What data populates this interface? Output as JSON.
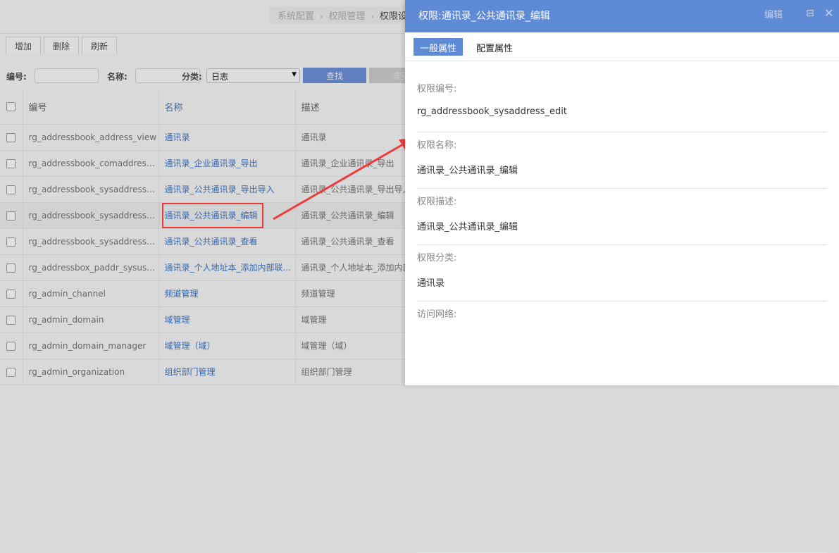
{
  "breadcrumb": [
    "系统配置",
    "权限管理",
    "权限设置"
  ],
  "toolbar": {
    "add": "增加",
    "delete": "删除",
    "refresh": "刷新"
  },
  "filter": {
    "id_label": "编号:",
    "id_value": "",
    "name_label": "名称:",
    "name_value": "",
    "category_label": "分类:",
    "category_value": "日志",
    "search": "查找",
    "clear": "清空"
  },
  "table": {
    "headers": [
      "编号",
      "名称",
      "描述"
    ],
    "rows": [
      {
        "id": "rg_addressbook_address_view",
        "name": "通讯录",
        "desc": "通讯录"
      },
      {
        "id": "rg_addressbook_comaddress_d...",
        "name": "通讯录_企业通讯录_导出",
        "desc": "通讯录_企业通讯录_导出"
      },
      {
        "id": "rg_addressbook_sysaddress_du...",
        "name": "通讯录_公共通讯录_导出导入",
        "desc": "通讯录_公共通讯录_导出导入"
      },
      {
        "id": "rg_addressbook_sysaddress_edit",
        "name": "通讯录_公共通讯录_编辑",
        "desc": "通讯录_公共通讯录_编辑"
      },
      {
        "id": "rg_addressbook_sysaddress_view",
        "name": "通讯录_公共通讯录_查看",
        "desc": "通讯录_公共通讯录_查看"
      },
      {
        "id": "rg_addressbox_paddr_sysusera...",
        "name": "通讯录_个人地址本_添加内部联...",
        "desc": "通讯录_个人地址本_添加内部联系人"
      },
      {
        "id": "rg_admin_channel",
        "name": "频道管理",
        "desc": "频道管理"
      },
      {
        "id": "rg_admin_domain",
        "name": "域管理",
        "desc": "域管理"
      },
      {
        "id": "rg_admin_domain_manager",
        "name": "域管理（域）",
        "desc": "域管理（域）"
      },
      {
        "id": "rg_admin_organization",
        "name": "组织部门管理",
        "desc": "组织部门管理"
      }
    ]
  },
  "panel": {
    "title": "权限:通讯录_公共通讯录_编辑",
    "edit": "编辑",
    "tabs": [
      "一般属性",
      "配置属性"
    ],
    "fields": [
      {
        "label": "权限编号:",
        "value": "rg_addressbook_sysaddress_edit"
      },
      {
        "label": "权限名称:",
        "value": "通讯录_公共通讯录_编辑"
      },
      {
        "label": "权限描述:",
        "value": "通讯录_公共通讯录_编辑"
      },
      {
        "label": "权限分类:",
        "value": "通讯录"
      },
      {
        "label": "访问网络:",
        "value": ""
      }
    ]
  },
  "colors": {
    "accent": "#5f8ad6",
    "link": "#3467b0",
    "highlight": "#e93a3a"
  }
}
